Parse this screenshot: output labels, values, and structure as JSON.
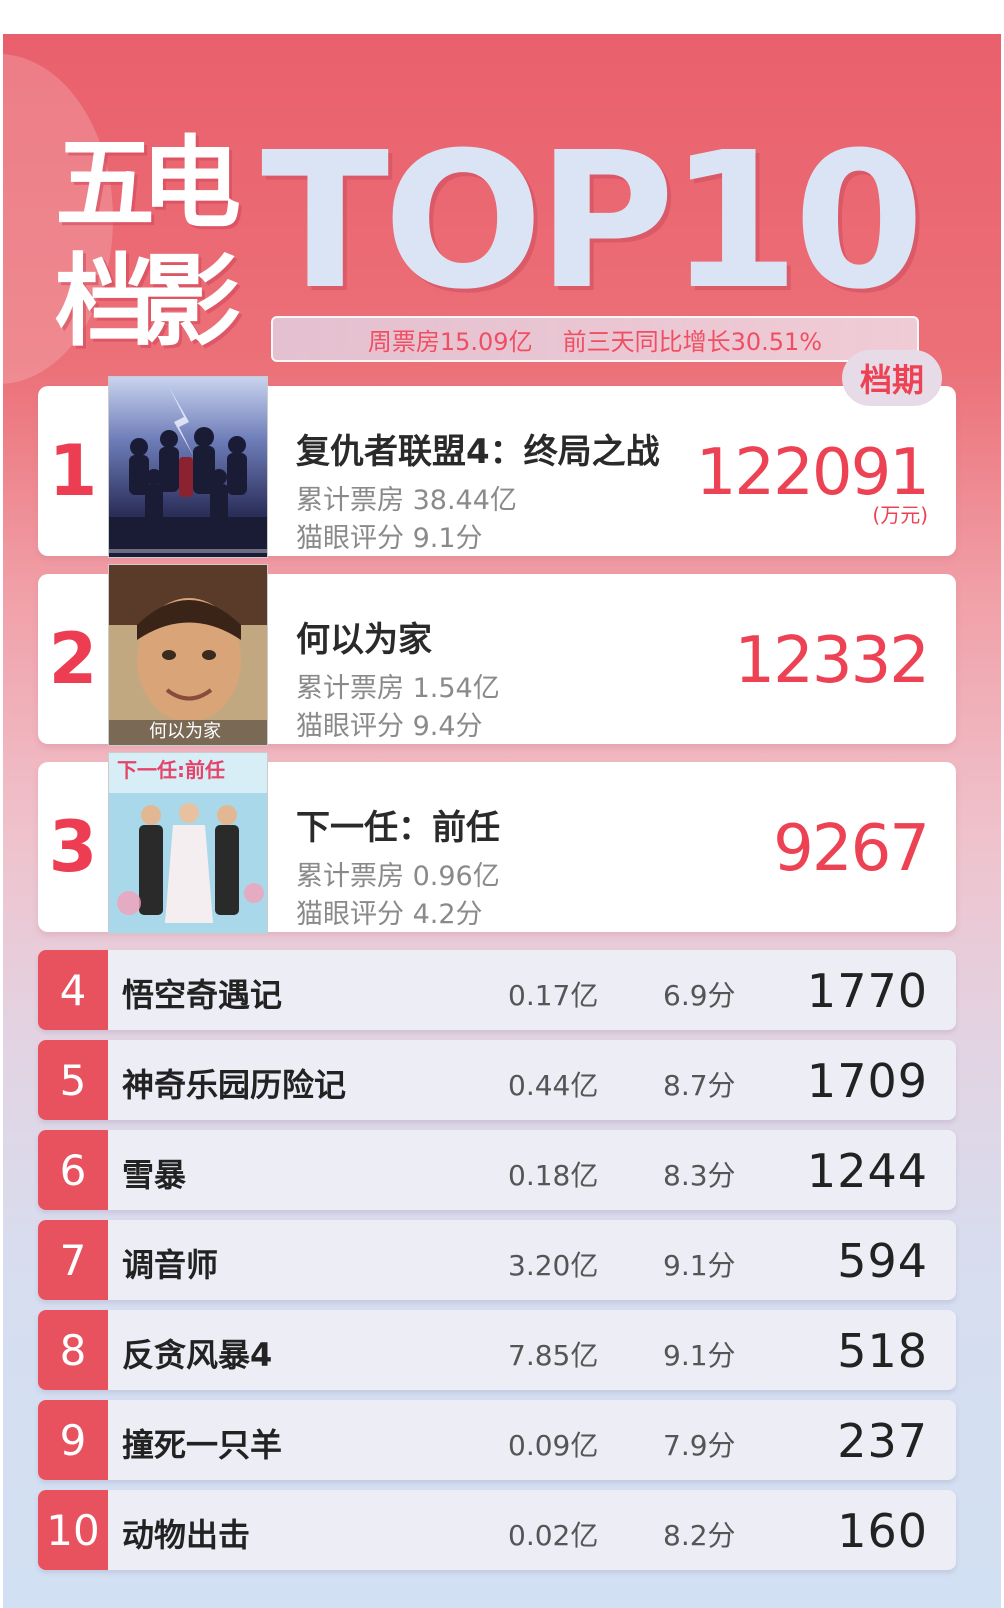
{
  "header": {
    "cn_chars": [
      "五",
      "电",
      "档",
      "影"
    ],
    "top_label": "TOP10",
    "summary_left": "周票房15.09亿",
    "summary_right": "前三天同比增长30.51%"
  },
  "badge": "档期",
  "unit": "(万元)",
  "top3": [
    {
      "rank": "1",
      "title": "复仇者联盟4：终局之战",
      "gross": "累计票房 38.44亿",
      "score": "猫眼评分  9.1分",
      "value": "122091"
    },
    {
      "rank": "2",
      "title": "何以为家",
      "gross": "累计票房  1.54亿",
      "score": "猫眼评分  9.4分",
      "value": "12332"
    },
    {
      "rank": "3",
      "title": "下一任：前任",
      "gross": "累计票房  0.96亿",
      "score": "猫眼评分 4.2分",
      "value": "9267"
    }
  ],
  "rows": [
    {
      "rank": "4",
      "title": "悟空奇遇记",
      "gross": "0.17亿",
      "score": "6.9分",
      "value": "1770"
    },
    {
      "rank": "5",
      "title": "神奇乐园历险记",
      "gross": "0.44亿",
      "score": "8.7分",
      "value": "1709"
    },
    {
      "rank": "6",
      "title": "雪暴",
      "gross": "0.18亿",
      "score": "8.3分",
      "value": "1244"
    },
    {
      "rank": "7",
      "title": "调音师",
      "gross": "3.20亿",
      "score": "9.1分",
      "value": "594"
    },
    {
      "rank": "8",
      "title": "反贪风暴4",
      "gross": "7.85亿",
      "score": "9.1分",
      "value": "518"
    },
    {
      "rank": "9",
      "title": "撞死一只羊",
      "gross": "0.09亿",
      "score": "7.9分",
      "value": "237"
    },
    {
      "rank": "10",
      "title": "动物出击",
      "gross": "0.02亿",
      "score": "8.2分",
      "value": "160"
    }
  ],
  "colors": {
    "accent": "#ec4253",
    "rank_bg": "#e8525f"
  }
}
